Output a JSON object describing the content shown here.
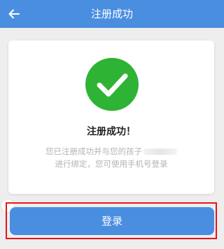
{
  "header": {
    "title": "注册成功",
    "back_icon": "arrow-left-icon"
  },
  "card": {
    "status_icon": "check-circle-icon",
    "status_color": "#2fb335",
    "heading": "注册成功！",
    "message_line1": "您已注册成功并与您的孩子",
    "message_line2": "进行绑定，您可使用手机号登录"
  },
  "actions": {
    "login_label": "登录",
    "accent_color": "#4a8ee0",
    "highlight_color": "#e8141b"
  }
}
